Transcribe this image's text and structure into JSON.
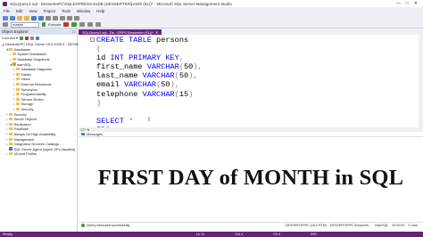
{
  "window": {
    "title": "SQLQuery1.sql - DesserterPC\\SQLEXPRESS.ExDB (DESSERTER\\jsmith (51))* - Microsoft SQL Server Management Studio",
    "controls": [
      "—",
      "□",
      "✕"
    ]
  },
  "menu": [
    "File",
    "Edit",
    "View",
    "Project",
    "Tools",
    "Window",
    "Help"
  ],
  "toolbar2": {
    "database": "master",
    "execute_label": "Execute"
  },
  "object_explorer": {
    "title": "Object Explorer",
    "connect_label": "Connect ▾",
    "items": [
      {
        "indent": 0,
        "toggle": "◢",
        "icon": "server",
        "label": "DesserterPC (SQL Server 15.0.2000.5 - DESSERTERPC)"
      },
      {
        "indent": 1,
        "toggle": "◢",
        "icon": "folder",
        "label": "Databases"
      },
      {
        "indent": 2,
        "toggle": "▷",
        "icon": "folder",
        "label": "System Databases"
      },
      {
        "indent": 2,
        "toggle": "▷",
        "icon": "folder",
        "label": "Database Snapshots"
      },
      {
        "indent": 2,
        "toggle": "◢",
        "icon": "db",
        "label": "learnSQL"
      },
      {
        "indent": 3,
        "toggle": "▷",
        "icon": "folder",
        "label": "Database Diagrams"
      },
      {
        "indent": 3,
        "toggle": "▷",
        "icon": "folder",
        "label": "Tables"
      },
      {
        "indent": 3,
        "toggle": "▷",
        "icon": "folder",
        "label": "Views"
      },
      {
        "indent": 3,
        "toggle": "▷",
        "icon": "folder",
        "label": "External Resources"
      },
      {
        "indent": 3,
        "toggle": "▷",
        "icon": "folder",
        "label": "Synonyms"
      },
      {
        "indent": 3,
        "toggle": "▷",
        "icon": "folder",
        "label": "Programmability"
      },
      {
        "indent": 3,
        "toggle": "▷",
        "icon": "folder",
        "label": "Service Broker"
      },
      {
        "indent": 3,
        "toggle": "▷",
        "icon": "folder",
        "label": "Storage"
      },
      {
        "indent": 3,
        "toggle": "▷",
        "icon": "folder",
        "label": "Security"
      },
      {
        "indent": 1,
        "toggle": "▷",
        "icon": "folder",
        "label": "Security"
      },
      {
        "indent": 1,
        "toggle": "▷",
        "icon": "folder",
        "label": "Server Objects"
      },
      {
        "indent": 1,
        "toggle": "▷",
        "icon": "folder",
        "label": "Replication"
      },
      {
        "indent": 1,
        "toggle": "▷",
        "icon": "folder",
        "label": "PolyBase"
      },
      {
        "indent": 1,
        "toggle": "▷",
        "icon": "folder",
        "label": "Always On High Availability"
      },
      {
        "indent": 1,
        "toggle": "▷",
        "icon": "folder",
        "label": "Management"
      },
      {
        "indent": 1,
        "toggle": "▷",
        "icon": "folder",
        "label": "Integration Services Catalogs"
      },
      {
        "indent": 1,
        "toggle": "",
        "icon": "server",
        "label": "SQL Server Agent (Agent XPs disabled)"
      },
      {
        "indent": 1,
        "toggle": "▷",
        "icon": "folder",
        "label": "XEvent Profiler"
      }
    ]
  },
  "editor": {
    "tab_label": "SQLQuery1.sql - De...ERPC\\Desserter (51))*",
    "tab_close": "✕",
    "collapse_glyph": "−",
    "lines": [
      [
        {
          "t": "CREATE TABLE",
          "c": "kw"
        },
        {
          "t": " persons",
          "c": "ln"
        }
      ],
      [
        {
          "t": "(",
          "c": "gr"
        }
      ],
      [
        {
          "t": "id ",
          "c": "ln"
        },
        {
          "t": "INT PRIMARY KEY",
          "c": "kw"
        },
        {
          "t": ",",
          "c": "gr"
        }
      ],
      [
        {
          "t": "first_name ",
          "c": "ln"
        },
        {
          "t": "VARCHAR",
          "c": "ty"
        },
        {
          "t": "(",
          "c": "gr"
        },
        {
          "t": "50",
          "c": "ln"
        },
        {
          "t": "),",
          "c": "gr"
        }
      ],
      [
        {
          "t": "last_name ",
          "c": "ln"
        },
        {
          "t": "VARCHAR",
          "c": "ty"
        },
        {
          "t": "(",
          "c": "gr"
        },
        {
          "t": "50",
          "c": "ln"
        },
        {
          "t": "),",
          "c": "gr"
        }
      ],
      [
        {
          "t": "email ",
          "c": "ln"
        },
        {
          "t": "VARCHAR",
          "c": "ty"
        },
        {
          "t": "(",
          "c": "gr"
        },
        {
          "t": "50",
          "c": "ln"
        },
        {
          "t": "),",
          "c": "gr"
        }
      ],
      [
        {
          "t": "telephone ",
          "c": "ln"
        },
        {
          "t": "VARCHAR",
          "c": "ty"
        },
        {
          "t": "(",
          "c": "gr"
        },
        {
          "t": "15",
          "c": "ln"
        },
        {
          "t": ")",
          "c": "gr"
        }
      ],
      [
        {
          "t": ")",
          "c": "gr"
        }
      ],
      [
        {
          "t": "",
          "c": "ln"
        }
      ],
      [
        {
          "t": "SELECT",
          "c": "kw"
        },
        {
          "t": " *",
          "c": "gr"
        }
      ],
      [
        {
          "t": "FRO",
          "c": "kw"
        }
      ]
    ],
    "cursor_glyph": "I",
    "zoom": "177 %"
  },
  "results": {
    "tab_label": "Messages"
  },
  "overlay_title": "FIRST DAY of MONTH in SQL",
  "status": {
    "message": "Query executed successfully.",
    "right": [
      "DESSERTERPC (15.0 RTM)",
      "DESSERTERPC\\Desserter...",
      "learnSQL",
      "00:00:00",
      "0 rows"
    ]
  },
  "statusbar": {
    "ready": "Ready",
    "ln": "Ln 11",
    "col": "Col 4",
    "ch": "Ch 4",
    "mode": "INS"
  },
  "colors": {
    "accent": "#68217a",
    "keyword": "#0000ff",
    "punct": "#808080"
  }
}
